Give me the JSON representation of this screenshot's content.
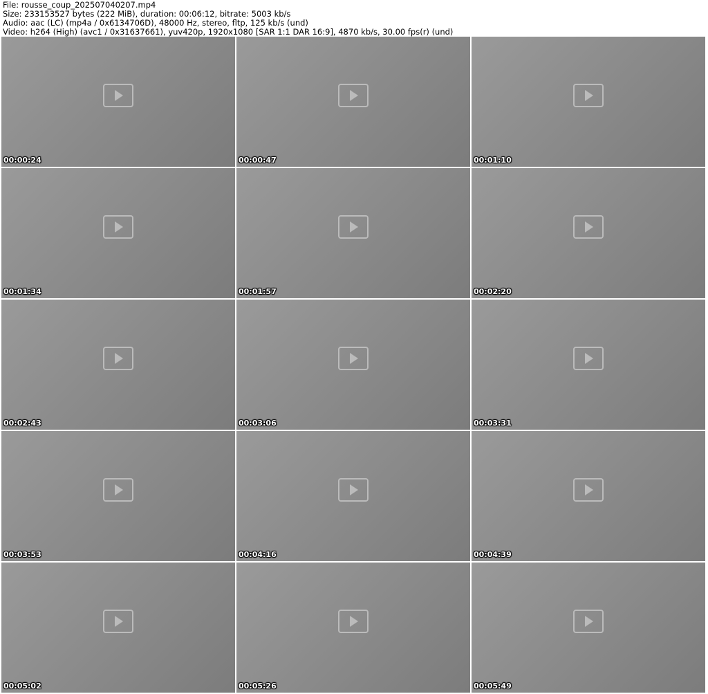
{
  "header": {
    "file": "File: rousse_coup_202507040207.mp4",
    "size": "Size: 233153527 bytes (222 MiB), duration: 00:06:12, bitrate: 5003 kb/s",
    "audio": "Audio: aac (LC) (mp4a / 0x6134706D), 48000 Hz, stereo, fltp, 125 kb/s (und)",
    "video": "Video: h264 (High) (avc1 / 0x31637661), yuv420p, 1920x1080 [SAR 1:1 DAR 16:9], 4870 kb/s, 30.00 fps(r) (und)"
  },
  "thumbnails": [
    {
      "timestamp": "00:00:24"
    },
    {
      "timestamp": "00:00:47"
    },
    {
      "timestamp": "00:01:10"
    },
    {
      "timestamp": "00:01:34"
    },
    {
      "timestamp": "00:01:57"
    },
    {
      "timestamp": "00:02:20"
    },
    {
      "timestamp": "00:02:43"
    },
    {
      "timestamp": "00:03:06"
    },
    {
      "timestamp": "00:03:31"
    },
    {
      "timestamp": "00:03:53"
    },
    {
      "timestamp": "00:04:16"
    },
    {
      "timestamp": "00:04:39"
    },
    {
      "timestamp": "00:05:02"
    },
    {
      "timestamp": "00:05:26"
    },
    {
      "timestamp": "00:05:49"
    }
  ]
}
